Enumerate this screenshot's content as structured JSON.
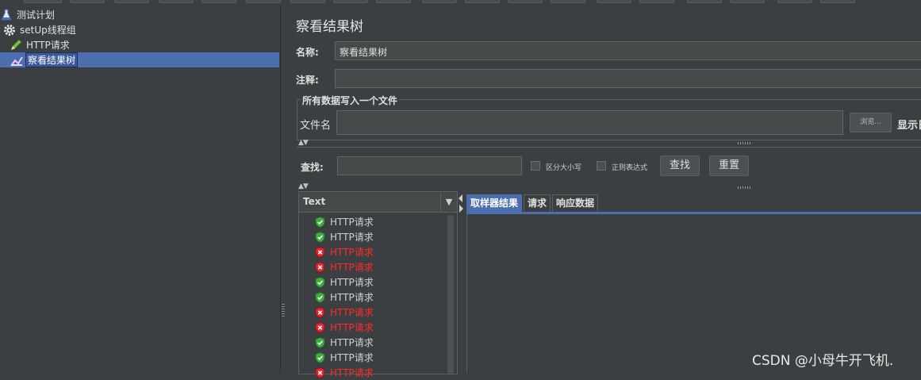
{
  "tree": {
    "items": [
      {
        "label": "测试计划",
        "icon": "flask-icon"
      },
      {
        "label": "setUp线程组",
        "icon": "gear-icon"
      },
      {
        "label": "HTTP请求",
        "icon": "pencil-icon"
      },
      {
        "label": "察看结果树",
        "icon": "chart-icon"
      }
    ]
  },
  "panel": {
    "title": "察看结果树",
    "name_label": "名称:",
    "name_value": "察看结果树",
    "comment_label": "注释:",
    "comment_value": "",
    "file_group_title": "所有数据写入一个文件",
    "filename_label": "文件名",
    "filename_value": "",
    "browse_button": "浏览...",
    "show_label": "显示日",
    "search_label": "查找:",
    "search_value": "",
    "case_checkbox": "区分大小写",
    "regex_checkbox": "正则表达式",
    "find_button": "查找",
    "reset_button": "重置"
  },
  "results": {
    "renderer": "Text",
    "items": [
      {
        "label": "HTTP请求",
        "status": "success"
      },
      {
        "label": "HTTP请求",
        "status": "success"
      },
      {
        "label": "HTTP请求",
        "status": "error"
      },
      {
        "label": "HTTP请求",
        "status": "error"
      },
      {
        "label": "HTTP请求",
        "status": "success"
      },
      {
        "label": "HTTP请求",
        "status": "success"
      },
      {
        "label": "HTTP请求",
        "status": "error"
      },
      {
        "label": "HTTP请求",
        "status": "error"
      },
      {
        "label": "HTTP请求",
        "status": "success"
      },
      {
        "label": "HTTP请求",
        "status": "success"
      },
      {
        "label": "HTTP请求",
        "status": "error"
      }
    ]
  },
  "tabs": [
    {
      "label": "取样器结果",
      "active": true
    },
    {
      "label": "请求",
      "active": false
    },
    {
      "label": "响应数据",
      "active": false
    }
  ],
  "watermark": "CSDN @小母牛开飞机.",
  "colors": {
    "background": "#3c3f41",
    "selection": "#4b6eaf",
    "success": "#3fae3f",
    "error": "#e0262e"
  }
}
